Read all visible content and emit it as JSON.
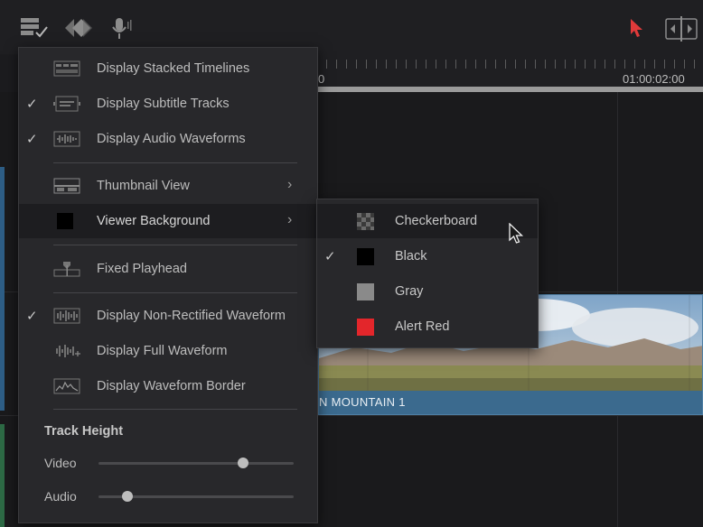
{
  "toolbar": {
    "icons": [
      "timeline-view-options-icon",
      "snapping-icon",
      "voiceover-mic-icon",
      "selection-pointer-icon",
      "trim-mode-icon"
    ],
    "accent_pointer_color": "#e03a3a"
  },
  "ruler": {
    "timecode_left": "0",
    "timecode_right": "01:00:02:00"
  },
  "clip": {
    "label": "N MOUNTAIN 1"
  },
  "menu": {
    "items": [
      {
        "label": "Display Stacked Timelines",
        "checked": false,
        "icon": "stacked-timelines-icon"
      },
      {
        "label": "Display Subtitle Tracks",
        "checked": true,
        "icon": "subtitle-tracks-icon"
      },
      {
        "label": "Display Audio Waveforms",
        "checked": true,
        "icon": "audio-waveforms-icon"
      },
      {
        "label": "Thumbnail View",
        "checked": false,
        "icon": "thumbnail-view-icon",
        "submenu": true
      },
      {
        "label": "Viewer Background",
        "checked": false,
        "icon": "viewer-background-swatch",
        "submenu": true,
        "active": true
      },
      {
        "label": "Fixed Playhead",
        "checked": false,
        "icon": "fixed-playhead-icon"
      },
      {
        "label": "Display Non-Rectified Waveform",
        "checked": true,
        "icon": "non-rectified-waveform-icon"
      },
      {
        "label": "Display Full Waveform",
        "checked": false,
        "icon": "full-waveform-icon"
      },
      {
        "label": "Display Waveform Border",
        "checked": false,
        "icon": "waveform-border-icon"
      }
    ],
    "check_glyph": "✓",
    "chevron_glyph": "›",
    "track_height": {
      "title": "Track Height",
      "video_label": "Video",
      "audio_label": "Audio",
      "video_value": 0.74,
      "audio_value": 0.15
    }
  },
  "submenu": {
    "items": [
      {
        "label": "Checkerboard",
        "checked": false,
        "color": "checker",
        "hover": true
      },
      {
        "label": "Black",
        "checked": true,
        "color": "#000000"
      },
      {
        "label": "Gray",
        "checked": false,
        "color": "#8a8a8a"
      },
      {
        "label": "Alert Red",
        "checked": false,
        "color": "#e3262b"
      }
    ]
  }
}
